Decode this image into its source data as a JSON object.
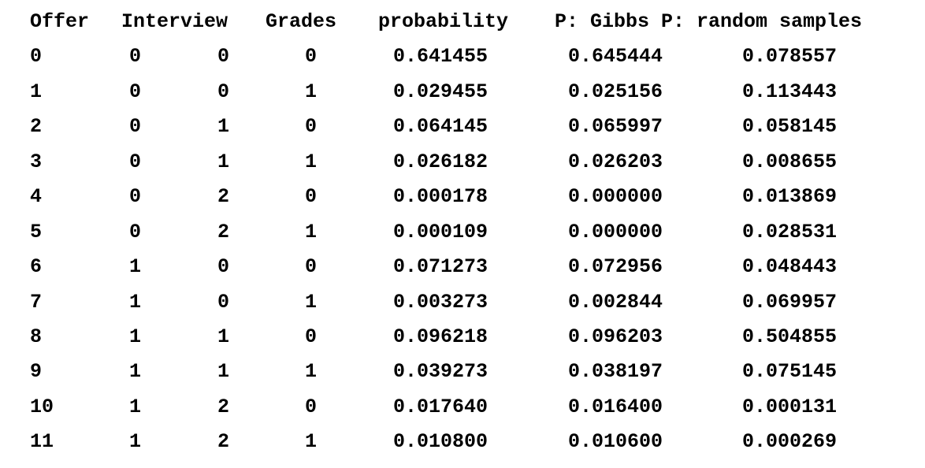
{
  "columns": [
    "Offer",
    "Interview",
    "Grades",
    "probability",
    "P: Gibbs P: random samples"
  ],
  "rows": [
    [
      "0",
      "0",
      "0",
      "0",
      "0.641455",
      "0.645444",
      "0.078557"
    ],
    [
      "1",
      "0",
      "0",
      "1",
      "0.029455",
      "0.025156",
      "0.113443"
    ],
    [
      "2",
      "0",
      "1",
      "0",
      "0.064145",
      "0.065997",
      "0.058145"
    ],
    [
      "3",
      "0",
      "1",
      "1",
      "0.026182",
      "0.026203",
      "0.008655"
    ],
    [
      "4",
      "0",
      "2",
      "0",
      "0.000178",
      "0.000000",
      "0.013869"
    ],
    [
      "5",
      "0",
      "2",
      "1",
      "0.000109",
      "0.000000",
      "0.028531"
    ],
    [
      "6",
      "1",
      "0",
      "0",
      "0.071273",
      "0.072956",
      "0.048443"
    ],
    [
      "7",
      "1",
      "0",
      "1",
      "0.003273",
      "0.002844",
      "0.069957"
    ],
    [
      "8",
      "1",
      "1",
      "0",
      "0.096218",
      "0.096203",
      "0.504855"
    ],
    [
      "9",
      "1",
      "1",
      "1",
      "0.039273",
      "0.038197",
      "0.075145"
    ],
    [
      "10",
      "1",
      "2",
      "0",
      "0.017640",
      "0.016400",
      "0.000131"
    ],
    [
      "11",
      "1",
      "2",
      "1",
      "0.010800",
      "0.010600",
      "0.000269"
    ]
  ]
}
